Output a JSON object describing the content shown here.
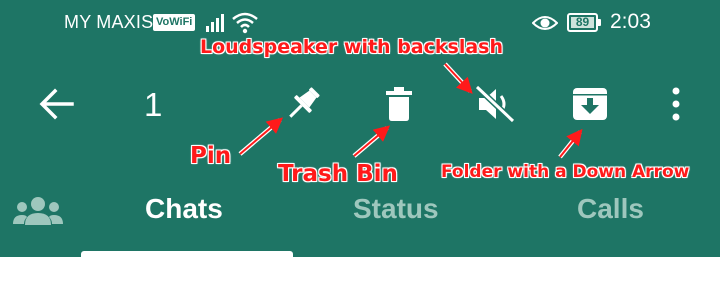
{
  "status_bar": {
    "carrier": "MY MAXIS",
    "vowifi_badge": "VoWiFi",
    "battery_level": "89",
    "time": "2:03"
  },
  "toolbar": {
    "selected_count": "1",
    "icons": [
      "back-arrow-icon",
      "pin-icon",
      "trash-icon",
      "mute-icon",
      "archive-icon",
      "overflow-menu-icon"
    ]
  },
  "annotations": {
    "pin": "Pin",
    "trash": "Trash Bin",
    "mute": "Loudspeaker with backslash",
    "archive": "Folder with a Down Arrow"
  },
  "tabs": [
    {
      "label": "Chats",
      "active": true
    },
    {
      "label": "Status",
      "active": false
    },
    {
      "label": "Calls",
      "active": false
    }
  ],
  "colors": {
    "app_bar": "#1e7565",
    "tab_inactive": "#9ec7bd",
    "annotation": "#ff1a1a"
  }
}
